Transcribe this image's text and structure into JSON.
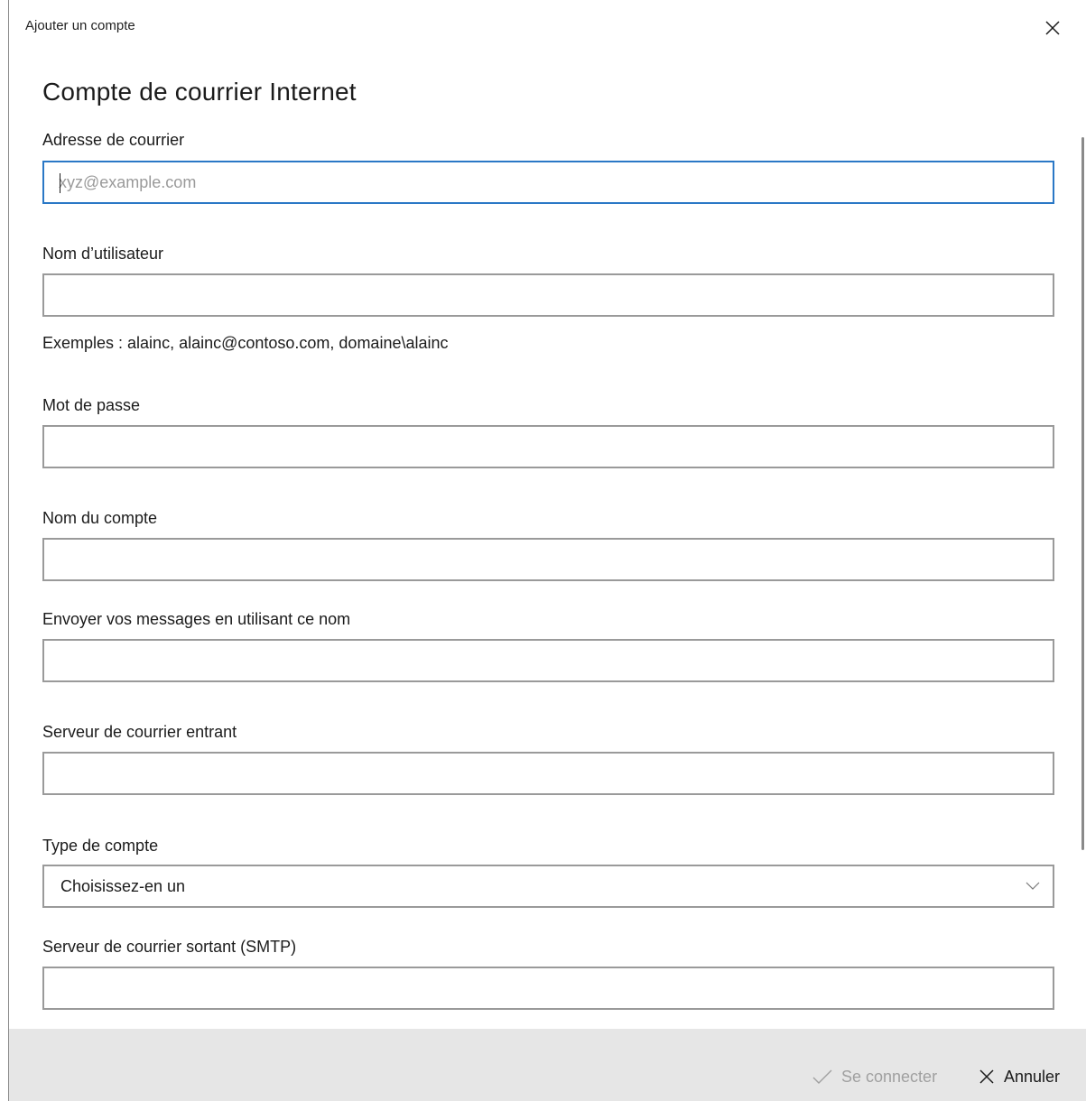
{
  "window": {
    "title": "Ajouter un compte"
  },
  "page": {
    "title": "Compte de courrier Internet"
  },
  "email": {
    "label": "Adresse de courrier",
    "placeholder": "xyz@example.com",
    "value": ""
  },
  "username": {
    "label": "Nom d’utilisateur",
    "value": "",
    "hint": "Exemples : alainc, alainc@contoso.com, domaine\\alainc"
  },
  "password": {
    "label": "Mot de passe",
    "value": ""
  },
  "account_name": {
    "label": "Nom du compte",
    "value": ""
  },
  "send_name": {
    "label": "Envoyer vos messages en utilisant ce nom",
    "value": ""
  },
  "incoming_server": {
    "label": "Serveur de courrier entrant",
    "value": ""
  },
  "account_type": {
    "label": "Type de compte",
    "selected": "Choisissez-en un"
  },
  "outgoing_server": {
    "label": "Serveur de courrier sortant (SMTP)",
    "value": ""
  },
  "footer": {
    "connect_label": "Se connecter",
    "cancel_label": "Annuler"
  },
  "colors": {
    "focus_border": "#2a78c6",
    "footer_bg": "#e6e6e6",
    "disabled_text": "#a0a0a0"
  }
}
